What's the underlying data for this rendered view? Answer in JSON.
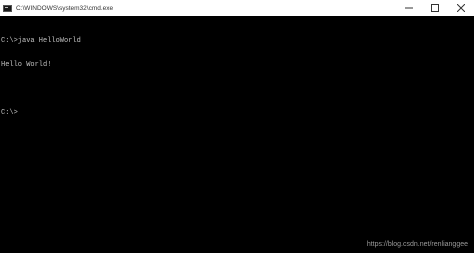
{
  "window": {
    "title": "C:\\WINDOWS\\system32\\cmd.exe",
    "icon": "cmd-icon"
  },
  "controls": {
    "minimize_icon": "minimize-icon",
    "maximize_icon": "maximize-icon",
    "close_icon": "close-icon"
  },
  "console": {
    "lines": [
      "C:\\>java HelloWorld",
      "Hello World!",
      "",
      "C:\\>"
    ],
    "text_color": "#c0c0c0",
    "background": "#000000"
  },
  "watermark": "https://blog.csdn.net/renlianggee"
}
